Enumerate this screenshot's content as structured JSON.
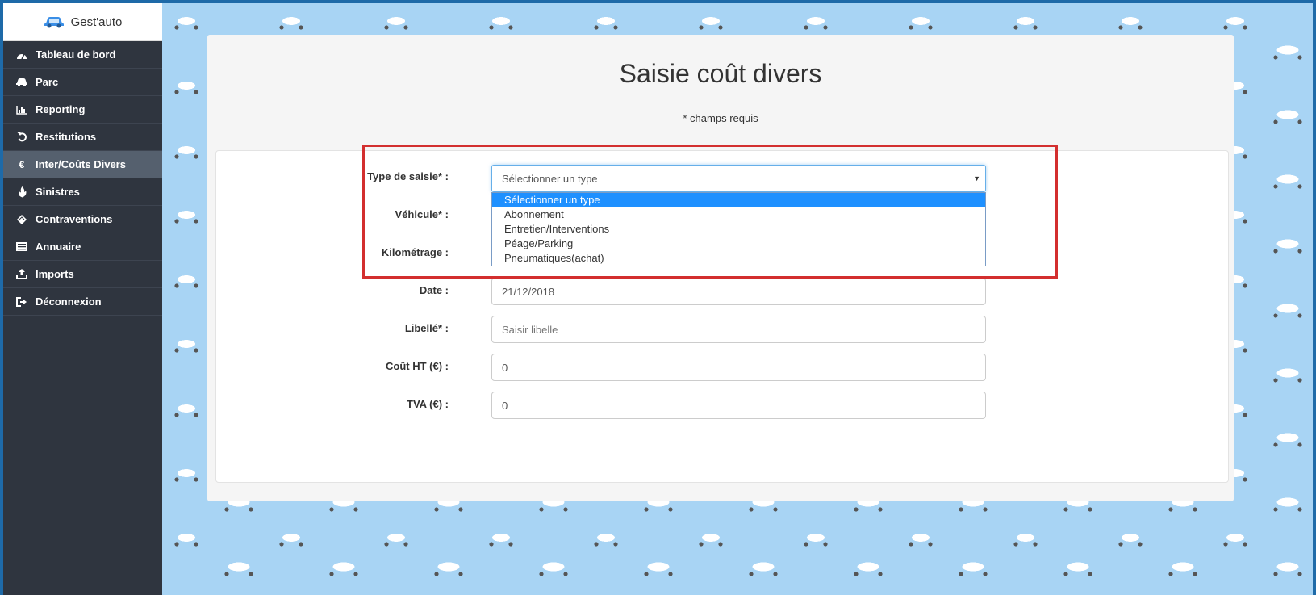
{
  "brand": {
    "name": "Gest'auto",
    "icon": "car-icon"
  },
  "sidebar": {
    "items": [
      {
        "label": "Tableau de bord",
        "icon": "dashboard-icon",
        "active": false
      },
      {
        "label": "Parc",
        "icon": "car-icon",
        "active": false
      },
      {
        "label": "Reporting",
        "icon": "bar-chart-icon",
        "active": false
      },
      {
        "label": "Restitutions",
        "icon": "undo-icon",
        "active": false
      },
      {
        "label": "Inter/Coûts Divers",
        "icon": "euro-icon",
        "active": true
      },
      {
        "label": "Sinistres",
        "icon": "fire-icon",
        "active": false
      },
      {
        "label": "Contraventions",
        "icon": "ticket-icon",
        "active": false
      },
      {
        "label": "Annuaire",
        "icon": "list-icon",
        "active": false
      },
      {
        "label": "Imports",
        "icon": "upload-icon",
        "active": false
      },
      {
        "label": "Déconnexion",
        "icon": "logout-icon",
        "active": false
      }
    ]
  },
  "page": {
    "title": "Saisie coût divers",
    "required_note": "* champs requis"
  },
  "form": {
    "type_label": "Type de saisie* :",
    "type_selected": "Sélectionner un type",
    "type_options": [
      "Sélectionner un type",
      "Abonnement",
      "Entretien/Interventions",
      "Péage/Parking",
      "Pneumatiques(achat)"
    ],
    "vehicule_label": "Véhicule* :",
    "km_label": "Kilométrage :",
    "date_label": "Date :",
    "date_value": "21/12/2018",
    "libelle_label": "Libellé* :",
    "libelle_placeholder": "Saisir libelle",
    "cout_label": "Coût HT (€) :",
    "cout_value": "0",
    "tva_label": "TVA (€) :",
    "tva_value": "0"
  },
  "colors": {
    "sidebar_bg": "#2f353f",
    "sidebar_active": "#55606e",
    "highlight_border": "#d32f2f",
    "dropdown_selected": "#1e90ff",
    "pattern_bg": "#a8d4f4"
  }
}
